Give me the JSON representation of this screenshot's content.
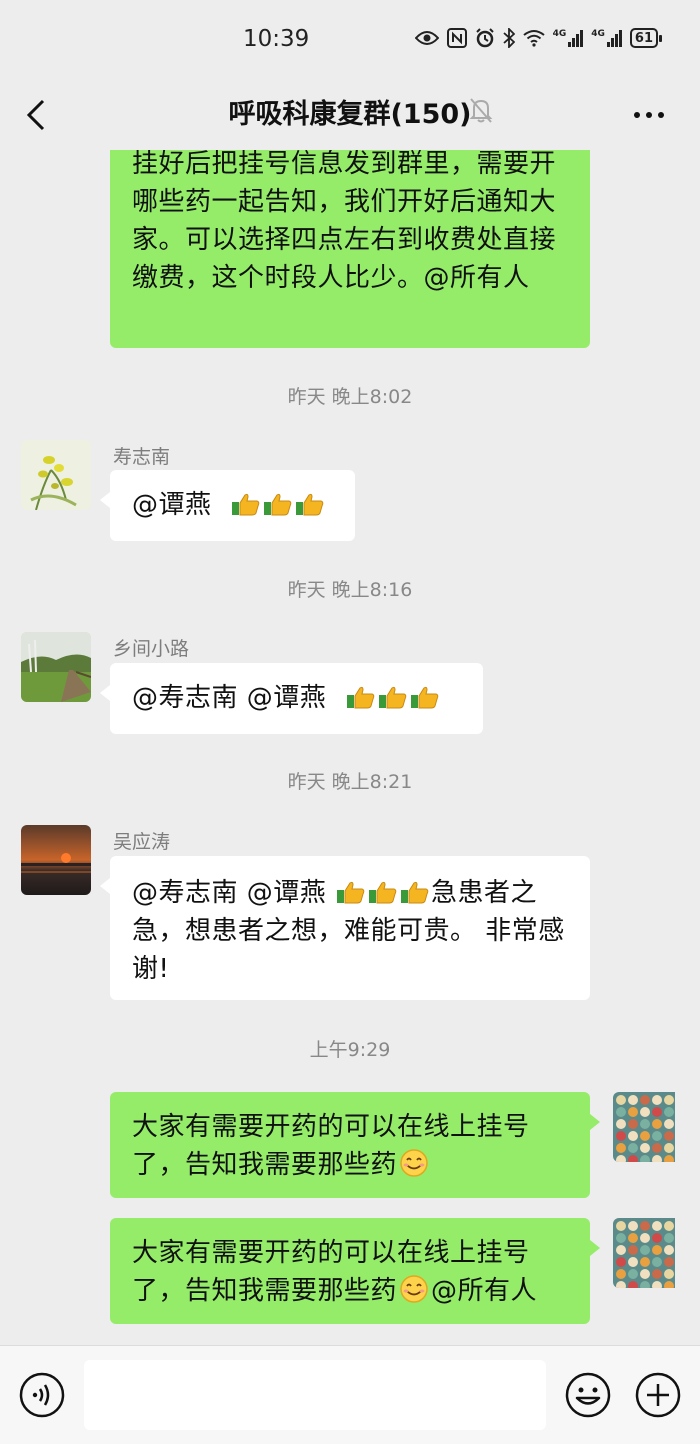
{
  "status_bar": {
    "time": "10:39",
    "battery": "61",
    "net1": "4G",
    "net2": "4G"
  },
  "header": {
    "title": "呼吸科康复群(150)"
  },
  "messages": [
    {
      "kind": "out",
      "text": "挂好后把挂号信息发到群里，需要开哪些药一起告知，我们开好后通知大家。可以选择四点左右到收费处直接缴费，这个时段人比少。@所有人"
    },
    {
      "kind": "time",
      "text": "昨天 晚上8:02"
    },
    {
      "kind": "in",
      "sender": "寿志南",
      "text": "@谭燕",
      "emoji": "thumbs-up x3"
    },
    {
      "kind": "time",
      "text": "昨天 晚上8:16"
    },
    {
      "kind": "in",
      "sender": "乡间小路",
      "text": "@寿志南  @谭燕",
      "emoji": "thumbs-up x3"
    },
    {
      "kind": "time",
      "text": "昨天 晚上8:21"
    },
    {
      "kind": "in",
      "sender": "吴应涛",
      "text_before": "@寿志南  @谭燕 ",
      "text_after": "急患者之急，想患者之想，难能可贵。 非常感谢!",
      "emoji": "thumbs-up x3"
    },
    {
      "kind": "time",
      "text": "上午9:29"
    },
    {
      "kind": "out",
      "text": "大家有需要开药的可以在线上挂号了，告知我需要那些药",
      "emoji": "smile"
    },
    {
      "kind": "out",
      "text_before": "大家有需要开药的可以在线上挂号了，告知我需要那些药",
      "text_after": "@所有人",
      "emoji": "smile"
    }
  ],
  "colors": {
    "out_bubble": "#95ec69",
    "in_bubble": "#ffffff",
    "background": "#ededed"
  },
  "icons": [
    "back-chevron-icon",
    "mute-bell-icon",
    "more-dots-icon",
    "voice-icon",
    "emoji-icon",
    "plus-icon"
  ]
}
